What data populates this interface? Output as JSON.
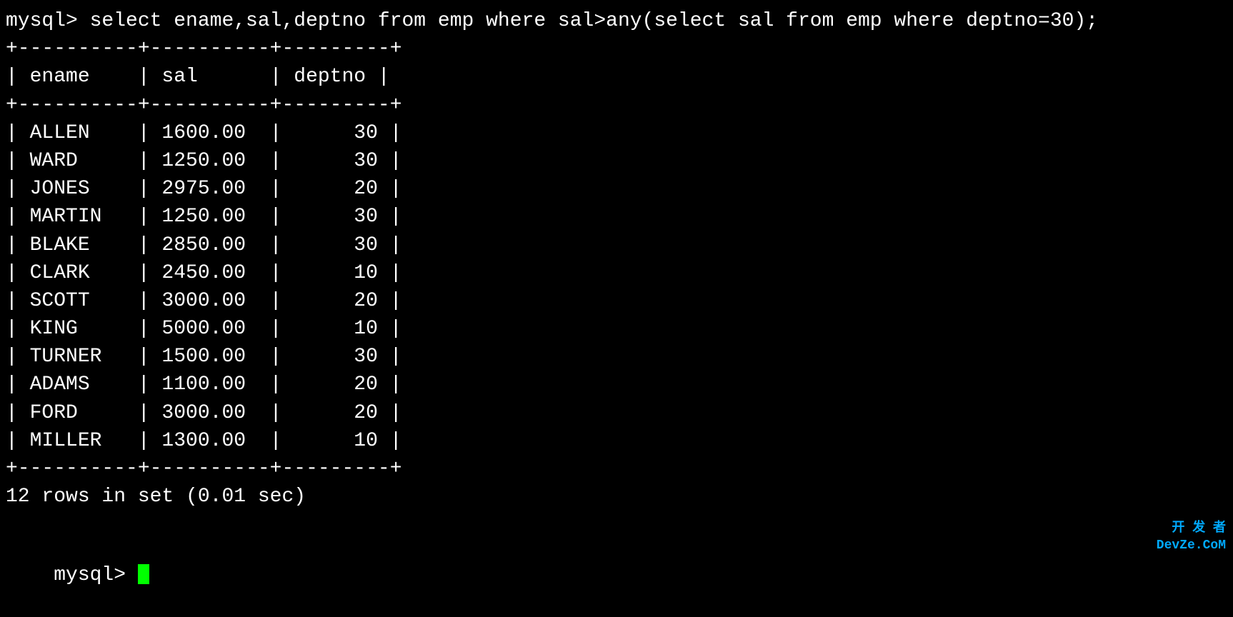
{
  "terminal": {
    "query_line": "mysql> select ename,sal,deptno from emp where sal>any(select sal from emp where deptno=30);",
    "border_top": "+----------+----------+---------+",
    "header_row": "| ename    | sal      | deptno |",
    "border_mid": "+----------+----------+---------+",
    "rows": [
      "| ALLEN    | 1600.00  |      30 |",
      "| WARD     | 1250.00  |      30 |",
      "| JONES    | 2975.00  |      20 |",
      "| MARTIN   | 1250.00  |      30 |",
      "| BLAKE    | 2850.00  |      30 |",
      "| CLARK    | 2450.00  |      10 |",
      "| SCOTT    | 3000.00  |      20 |",
      "| KING     | 5000.00  |      10 |",
      "| TURNER   | 1500.00  |      30 |",
      "| ADAMS    | 1100.00  |      20 |",
      "| FORD     | 3000.00  |      20 |",
      "| MILLER   | 1300.00  |      10 |"
    ],
    "border_bottom": "+----------+----------+---------+",
    "result_summary": "12 rows in set (0.01 sec)",
    "prompt": "mysql> ",
    "watermark_line1": "开 发 者",
    "watermark_line2": "DevZe.CoM"
  }
}
